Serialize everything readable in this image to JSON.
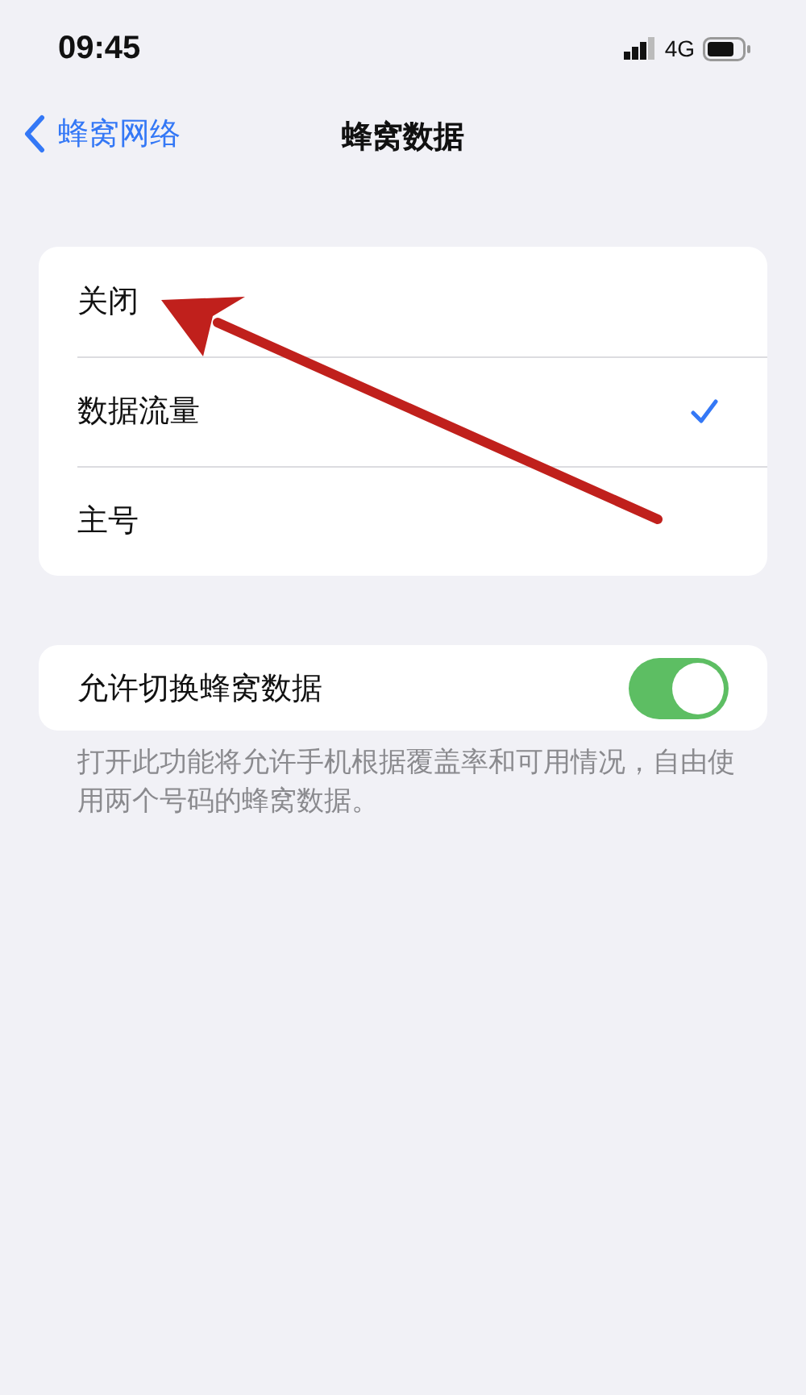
{
  "status_bar": {
    "time": "09:45",
    "network": "4G"
  },
  "nav": {
    "back_label": "蜂窝网络",
    "title": "蜂窝数据"
  },
  "options": [
    {
      "label": "关闭",
      "selected": false
    },
    {
      "label": "数据流量",
      "selected": true
    },
    {
      "label": "主号",
      "selected": false
    }
  ],
  "toggle_row": {
    "label": "允许切换蜂窝数据",
    "on": true
  },
  "footnote": "打开此功能将允许手机根据覆盖率和可用情况，自由使用两个号码的蜂窝数据。"
}
